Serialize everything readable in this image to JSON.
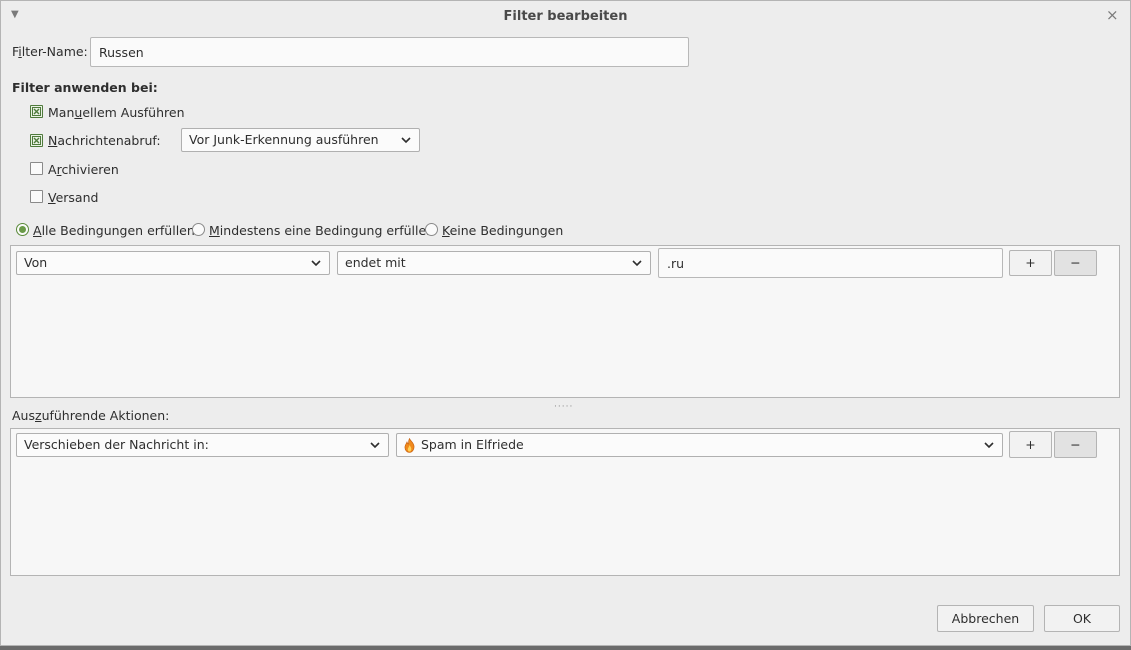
{
  "dialog": {
    "title": "Filter bearbeiten",
    "close_symbol": "×"
  },
  "filter_name": {
    "label_pre": "F",
    "label_accel": "i",
    "label_post": "lter-Name:",
    "value": "Russen"
  },
  "apply": {
    "heading": "Filter anwenden bei:",
    "manual": {
      "pre": "Man",
      "accel": "u",
      "post": "ellem Ausführen",
      "checked": true
    },
    "fetch": {
      "pre": "",
      "accel": "N",
      "post": "achrichtenabruf:",
      "checked": true,
      "option": "Vor Junk-Erkennung ausführen"
    },
    "archive": {
      "pre": "A",
      "accel": "r",
      "post": "chivieren",
      "checked": false
    },
    "send": {
      "pre": "",
      "accel": "V",
      "post": "ersand",
      "checked": false
    }
  },
  "match": {
    "all": {
      "pre": "",
      "accel": "A",
      "post": "lle Bedingungen erfüllen",
      "selected": true
    },
    "any": {
      "pre": "",
      "accel": "M",
      "post": "indestens eine Bedingung erfüllen",
      "selected": false
    },
    "none": {
      "pre": "",
      "accel": "K",
      "post": "eine Bedingungen",
      "selected": false
    }
  },
  "condition": {
    "field": "Von",
    "operator": "endet mit",
    "value": ".ru",
    "add": "+",
    "remove": "−"
  },
  "actions": {
    "label_pre": "Aus",
    "label_accel": "z",
    "label_post": "uführende Aktionen:",
    "action": "Verschieben der Nachricht in:",
    "target": "Spam in Elfriede",
    "add": "+",
    "remove": "−"
  },
  "buttons": {
    "cancel": "Abbrechen",
    "ok": "OK"
  },
  "colors": {
    "check_green": "#4f7a3c",
    "flame_orange": "#f08a1c"
  },
  "icons": {
    "target_folder": "flame-icon"
  }
}
